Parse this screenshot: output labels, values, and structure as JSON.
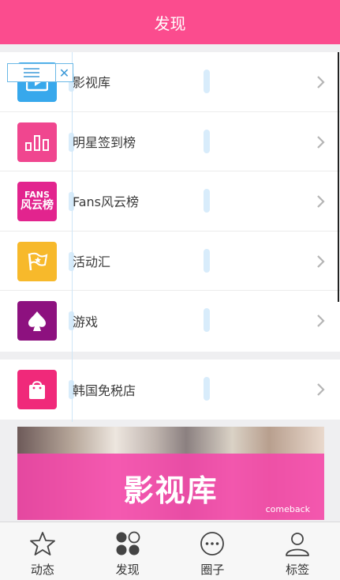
{
  "header": {
    "title": "发现"
  },
  "menu": {
    "items": [
      {
        "label": "影视库",
        "icon": "film-icon",
        "color": "#37a8ec"
      },
      {
        "label": "明星签到榜",
        "icon": "bar-chart-icon",
        "color": "#f0468f"
      },
      {
        "label": "Fans风云榜",
        "icon": "fans-badge-icon",
        "color": "#e2248e",
        "badge_top": "FANS",
        "badge_bottom": "风云榜"
      },
      {
        "label": "活动汇",
        "icon": "flag-icon",
        "color": "#f7b92b"
      },
      {
        "label": "游戏",
        "icon": "spade-icon",
        "color": "#8d117f"
      }
    ],
    "shop": {
      "label": "韩国免税店",
      "icon": "shopping-bag-icon",
      "color": "#f0297a"
    }
  },
  "banner": {
    "title": "影视库",
    "subtitle": "comeback"
  },
  "tabbar": {
    "items": [
      {
        "label": "动态",
        "icon": "star-icon"
      },
      {
        "label": "发现",
        "icon": "discover-icon"
      },
      {
        "label": "圈子",
        "icon": "chat-bubble-icon"
      },
      {
        "label": "标签",
        "icon": "person-icon"
      }
    ]
  }
}
